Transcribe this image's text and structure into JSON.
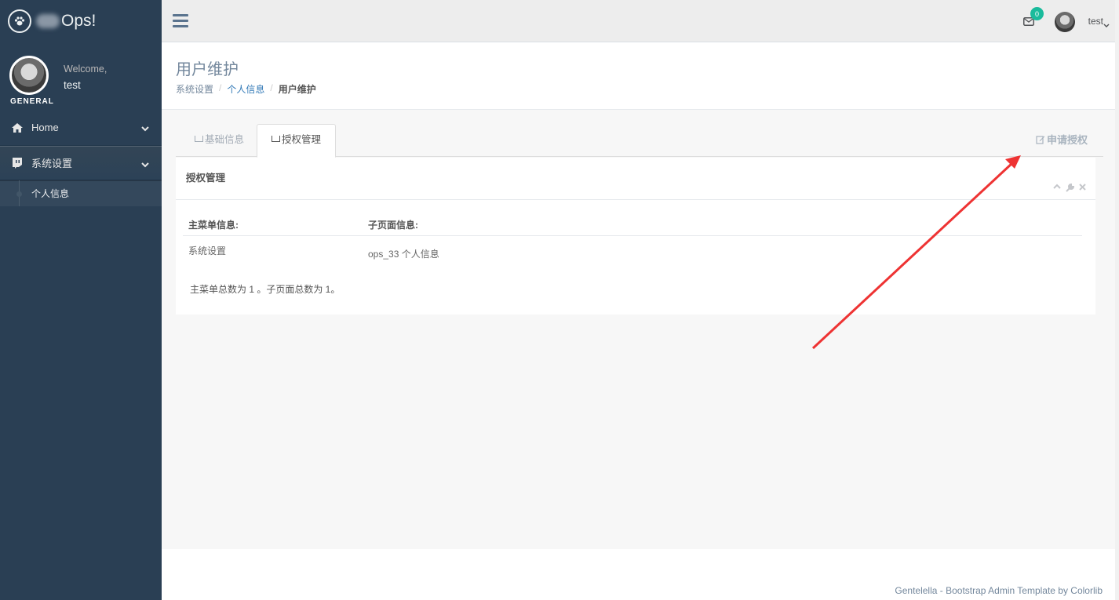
{
  "sidebar": {
    "brand": "Ops!",
    "welcome": "Welcome,",
    "username": "test",
    "section": "GENERAL",
    "menu": [
      {
        "label": "Home",
        "icon": "home-icon"
      },
      {
        "label": "系统设置",
        "icon": "twitch-icon"
      }
    ],
    "submenu": [
      {
        "label": "个人信息"
      }
    ]
  },
  "topnav": {
    "mail_count": "0",
    "user": "test"
  },
  "page": {
    "title": "用户维护",
    "breadcrumb": [
      "系统设置",
      "个人信息",
      "用户维护"
    ]
  },
  "tabs": [
    {
      "label": "基础信息",
      "active": false
    },
    {
      "label": "授权管理",
      "active": true
    }
  ],
  "apply_button": "申请授权",
  "panel": {
    "title": "授权管理",
    "columns": [
      "主菜单信息:",
      "子页面信息:"
    ],
    "rows": [
      [
        "系统设置",
        "ops_33 个人信息"
      ]
    ],
    "summary": "主菜单总数为 1 。子页面总数为 1。"
  },
  "footer": "Gentelella - Bootstrap Admin Template by Colorlib",
  "colors": {
    "sidebar_bg": "#2A3F54",
    "accent_green": "#1ABB9C",
    "link_blue": "#337AB7",
    "annotation_red": "#EE3333"
  }
}
